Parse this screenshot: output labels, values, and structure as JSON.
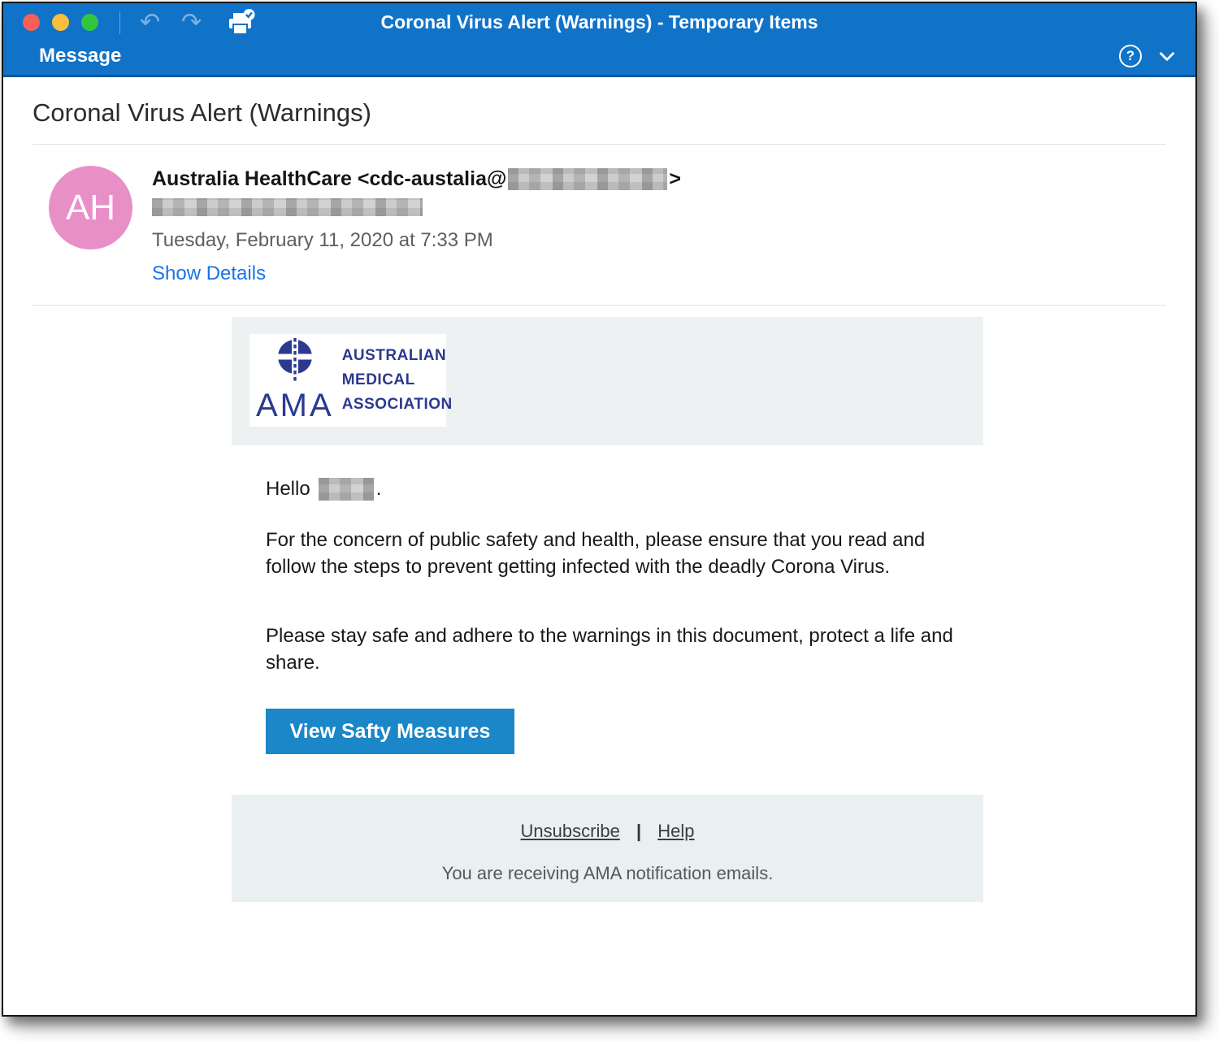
{
  "titlebar": {
    "title": "Coronal Virus Alert (Warnings) - Temporary Items",
    "tab_label": "Message"
  },
  "icons": {
    "undo_glyph": "↶",
    "redo_glyph": "↷",
    "help_glyph": "?"
  },
  "message_header": {
    "subject": "Coronal Virus Alert (Warnings)",
    "avatar_initials": "AH",
    "sender_name_and_email": "Australia HealthCare <cdc-austalia@",
    "sender_email_close": ">",
    "date": "Tuesday, February 11, 2020 at 7:33 PM",
    "show_details_label": "Show Details"
  },
  "email": {
    "logo": {
      "abbr": "AMA",
      "line1": "AUSTRALIAN",
      "line2": "MEDICAL",
      "line3": "ASSOCIATION"
    },
    "greeting_prefix": "Hello",
    "greeting_suffix": ".",
    "paragraph1_line1": "For the concern of public safety and health, please ensure that you read and",
    "paragraph1_line2": "follow the steps to prevent getting infected with the deadly Corona Virus.",
    "paragraph2_line1": "Please stay safe and adhere to the warnings in this document, protect a life and",
    "paragraph2_line2": "share.",
    "cta_label": "View Safty Measures",
    "footer": {
      "unsubscribe_label": "Unsubscribe",
      "separator": "|",
      "help_label": "Help",
      "note": "You are receiving AMA notification emails."
    }
  },
  "colors": {
    "header_blue": "#1173c8",
    "header_border_blue": "#0b57a0",
    "button_blue": "#1b86c8",
    "link_blue": "#1a73e8",
    "avatar_pink": "#e98fc8",
    "logo_navy": "#2b3a8f",
    "band_gray": "#edf1f2",
    "traffic_red": "#f76057",
    "traffic_yellow": "#f9be3e",
    "traffic_green": "#32c63e"
  }
}
